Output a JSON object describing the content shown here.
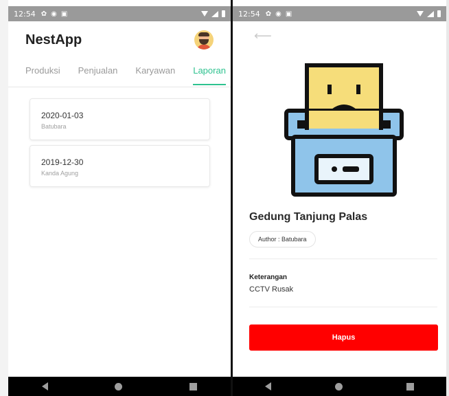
{
  "status_bar": {
    "time": "12:54"
  },
  "list_screen": {
    "app_title": "NestApp",
    "tabs": [
      {
        "label": "Produksi",
        "active": false
      },
      {
        "label": "Penjualan",
        "active": false
      },
      {
        "label": "Karyawan",
        "active": false
      },
      {
        "label": "Laporan",
        "active": true
      }
    ],
    "reports": [
      {
        "date": "2020-01-03",
        "author": "Batubara"
      },
      {
        "date": "2019-12-30",
        "author": "Kanda Agung"
      }
    ]
  },
  "detail_screen": {
    "back_icon": "arrow-left-icon",
    "title": "Gedung Tanjung Palas",
    "author_chip": "Author : Batubara",
    "keterangan_label": "Keterangan",
    "keterangan_value": "CCTV Rusak",
    "delete_label": "Hapus"
  },
  "colors": {
    "accent": "#2ec28f",
    "danger": "#ff0000"
  }
}
